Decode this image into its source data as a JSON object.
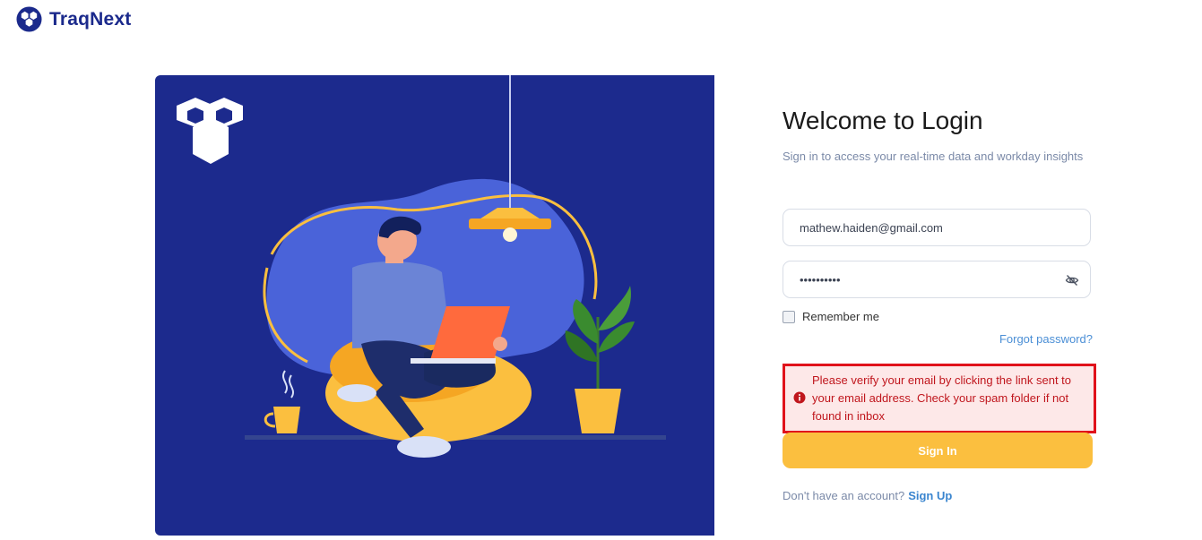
{
  "brand": {
    "name": "TraqNext",
    "color": "#1b2a8c"
  },
  "hero": {
    "background": "#1c2a8d",
    "accent": "#fbbf3f",
    "blob": "#4a63d9"
  },
  "login": {
    "title": "Welcome to Login",
    "subtitle": "Sign in to access your real-time data and workday insights",
    "email_value": "mathew.haiden@gmail.com",
    "password_value": "••••••••••",
    "password_toggle_icon": "eye-off-icon",
    "remember_label": "Remember me",
    "remember_checked": false,
    "forgot_label": "Forgot password?",
    "error_message": "Please verify your email by clicking the link sent to your email address. Check your spam folder if not found in inbox",
    "error_icon": "info-icon",
    "signin_label": "Sign In",
    "no_account_text": "Don't have an account?",
    "signup_label": "Sign Up"
  },
  "colors": {
    "primary": "#fbbf3f",
    "error": "#e0121b",
    "link": "#4b8fd6"
  }
}
